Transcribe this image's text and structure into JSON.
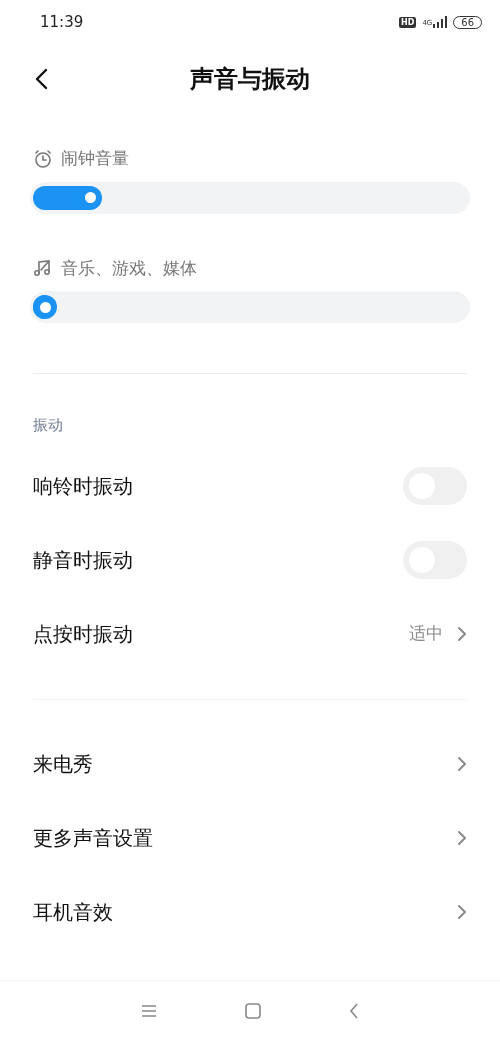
{
  "status_bar": {
    "time": "11:39",
    "hd": "HD",
    "network": "4G",
    "battery": "66"
  },
  "header": {
    "title": "声音与振动"
  },
  "volumes": [
    {
      "kind": "alarm",
      "label": "闹钟音量",
      "level": 0.11
    },
    {
      "kind": "media",
      "label": "音乐、游戏、媒体",
      "level": 0
    }
  ],
  "vibration": {
    "title": "振动",
    "items": [
      {
        "kind": "toggle",
        "label": "响铃时振动",
        "on": false
      },
      {
        "kind": "toggle",
        "label": "静音时振动",
        "on": false
      },
      {
        "kind": "link",
        "label": "点按时振动",
        "value": "适中"
      }
    ]
  },
  "more": [
    {
      "label": "来电秀"
    },
    {
      "label": "更多声音设置"
    },
    {
      "label": "耳机音效"
    }
  ]
}
